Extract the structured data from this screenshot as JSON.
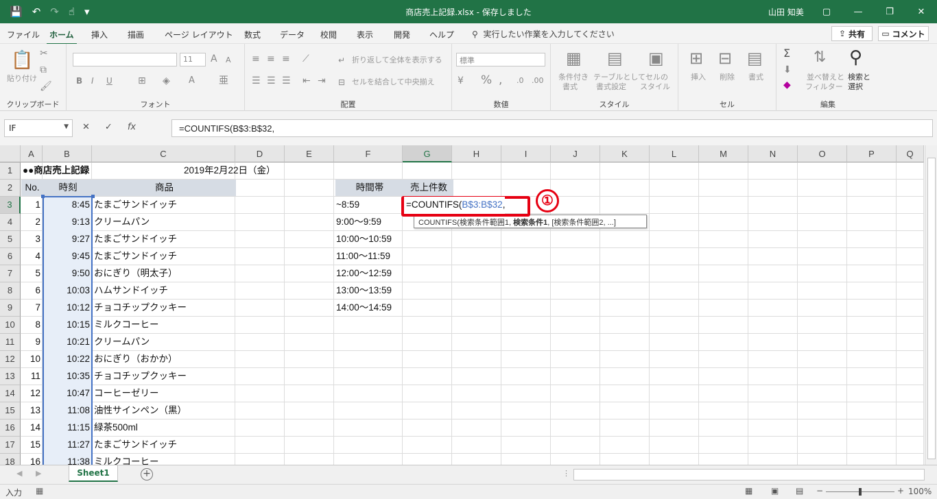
{
  "titlebar": {
    "title": "商店売上記録.xlsx  -  保存しました",
    "user": "山田 知美",
    "qat": [
      "💾",
      "↶",
      "↷",
      "☝",
      "▾"
    ],
    "window_buttons": [
      "▢",
      "—",
      "❐",
      "✕"
    ]
  },
  "menu": {
    "tabs": [
      "ファイル",
      "ホーム",
      "挿入",
      "描画",
      "ページ レイアウト",
      "数式",
      "データ",
      "校閲",
      "表示",
      "開発",
      "ヘルプ"
    ],
    "active_tab": "ホーム",
    "search_placeholder": "実行したい作業を入力してください",
    "share": "共有",
    "comment": "コメント"
  },
  "ribbon": {
    "clipboard": {
      "paste": "貼り付け",
      "label": "クリップボード"
    },
    "font": {
      "size": "11",
      "label": "フォント",
      "grow": "A",
      "shrink": "A"
    },
    "alignment": {
      "wrap": "折り返して全体を表示する",
      "merge": "セルを結合して中央揃え",
      "label": "配置"
    },
    "number": {
      "format": "標準",
      "label": "数値"
    },
    "styles": {
      "conditional_1": "条件付き",
      "conditional_2": "書式",
      "table_1": "テーブルとして",
      "table_2": "書式設定",
      "cell_1": "セルの",
      "cell_2": "スタイル",
      "label": "スタイル"
    },
    "cells": {
      "insert": "挿入",
      "delete": "削除",
      "format": "書式",
      "label": "セル"
    },
    "editing": {
      "sort_1": "並べ替えと",
      "sort_2": "フィルター",
      "find_1": "検索と",
      "find_2": "選択",
      "label": "編集"
    }
  },
  "formula_bar": {
    "name_box": "IF",
    "formula": "=COUNTIFS(B$3:B$32,"
  },
  "columns": [
    "A",
    "B",
    "C",
    "D",
    "E",
    "F",
    "G",
    "H",
    "I",
    "J",
    "K",
    "L",
    "M",
    "N",
    "O",
    "P",
    "Q"
  ],
  "rows": [
    "1",
    "2",
    "3",
    "4",
    "5",
    "6",
    "7",
    "8",
    "9",
    "10",
    "11",
    "12",
    "13",
    "14",
    "15",
    "16",
    "17",
    "18"
  ],
  "sheet": {
    "title": "●●商店売上記録",
    "date": "2019年2月22日（金）",
    "headers": {
      "no": "No.",
      "time": "時刻",
      "product": "商品",
      "slot": "時間帯",
      "count": "売上件数"
    },
    "records": [
      {
        "no": "1",
        "time": "8:45",
        "product": "たまごサンドイッチ"
      },
      {
        "no": "2",
        "time": "9:13",
        "product": "クリームパン"
      },
      {
        "no": "3",
        "time": "9:27",
        "product": "たまごサンドイッチ"
      },
      {
        "no": "4",
        "time": "9:45",
        "product": "たまごサンドイッチ"
      },
      {
        "no": "5",
        "time": "9:50",
        "product": "おにぎり（明太子）"
      },
      {
        "no": "6",
        "time": "10:03",
        "product": "ハムサンドイッチ"
      },
      {
        "no": "7",
        "time": "10:12",
        "product": "チョコチップクッキー"
      },
      {
        "no": "8",
        "time": "10:15",
        "product": "ミルクコーヒー"
      },
      {
        "no": "9",
        "time": "10:21",
        "product": "クリームパン"
      },
      {
        "no": "10",
        "time": "10:22",
        "product": "おにぎり（おかか）"
      },
      {
        "no": "11",
        "time": "10:35",
        "product": "チョコチップクッキー"
      },
      {
        "no": "12",
        "time": "10:47",
        "product": "コーヒーゼリー"
      },
      {
        "no": "13",
        "time": "11:08",
        "product": "油性サインペン（黒）"
      },
      {
        "no": "14",
        "time": "11:15",
        "product": "緑茶500ml"
      },
      {
        "no": "15",
        "time": "11:27",
        "product": "たまごサンドイッチ"
      },
      {
        "no": "16",
        "time": "11:38",
        "product": "ミルクコーヒー"
      }
    ],
    "slots": [
      "~8:59",
      "9:00～9:59",
      "10:00～10:59",
      "11:00～11:59",
      "12:00～12:59",
      "13:00～13:59",
      "14:00～14:59"
    ],
    "editing_prefix": "=COUNTIFS(",
    "editing_ref": "B$3:B$32",
    "editing_suffix": ",",
    "tooltip": {
      "pre": "COUNTIFS(検索条件範囲1, ",
      "bold": "検索条件1",
      "post": ", [検索条件範囲2, ...]"
    },
    "annotation": "①"
  },
  "sheetbar": {
    "tab": "Sheet1"
  },
  "status": {
    "mode": "入力",
    "zoom": "100%"
  }
}
